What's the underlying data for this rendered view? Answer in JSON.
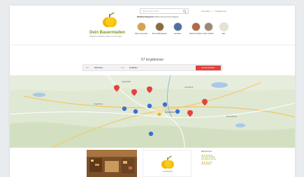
{
  "brand": {
    "name": "Dein Bauernladen",
    "tagline": "Regional einkaufen direkt vom Erzeuger"
  },
  "search": {
    "placeholder": "Was suchen Sie?"
  },
  "auth": {
    "login": "Anmelden",
    "separator": "|",
    "register": "Registrieren"
  },
  "categories": {
    "heading": "Beliebte Kategorien",
    "hint": "Klicken Sie auf eine Kategorie",
    "items": [
      {
        "label": "Obst & Gemüse",
        "color": "#d6a24a"
      },
      {
        "label": "Brot & Backwaren",
        "color": "#8a6a40"
      },
      {
        "label": "Getränke",
        "color": "#4f6fa0"
      },
      {
        "label": "Fleisch & Wurst",
        "color": "#b5673f"
      },
      {
        "label": "Käse & Milch",
        "color": "#a08870"
      },
      {
        "label": "Eier",
        "color": "#e8e3d0"
      }
    ]
  },
  "results": {
    "text": "57 Ergebnisse"
  },
  "filter": {
    "place_label": "Ort",
    "place_value": "München",
    "type_label": "Typ",
    "type_value": "Hofladen",
    "button": "Suche ändern",
    "accent": "#e2433f"
  },
  "map": {
    "cities": [
      "Augsburg",
      "München",
      "Rosenheim",
      "Landshut",
      "Ingolstadt"
    ],
    "marker_red": "#e2433f",
    "marker_blue": "#3b6fd1"
  },
  "side": {
    "title": "Bewertungen",
    "rating": "★★★★★",
    "reviews": [
      "Sehr gute Produkte",
      "Freundlicher Service",
      "Gerne wieder"
    ]
  }
}
